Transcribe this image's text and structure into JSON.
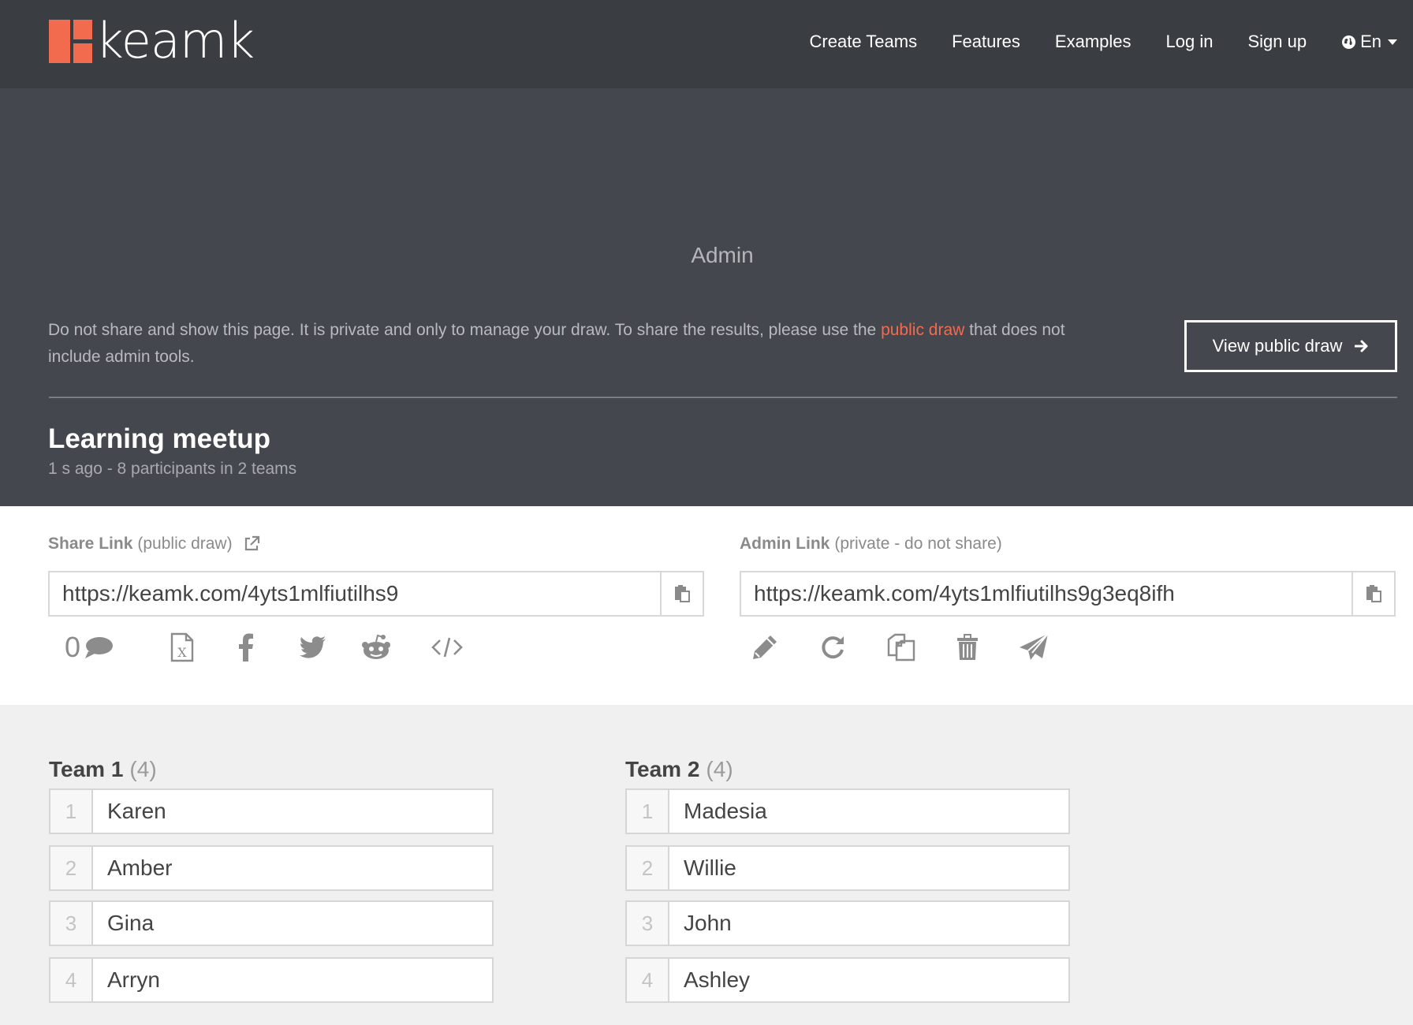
{
  "brand": {
    "name": "keamk",
    "accent": "#f26b4f"
  },
  "nav": {
    "items": [
      "Create Teams",
      "Features",
      "Examples",
      "Log in",
      "Sign up"
    ],
    "language": "En"
  },
  "hero": {
    "title": "Admin",
    "warning_before": "Do not share and show this page. It is private and only to manage your draw. To share the results, please use the ",
    "warning_link": "public draw",
    "warning_after": " that does not include admin tools.",
    "public_button": "View public draw",
    "draw_title": "Learning meetup",
    "draw_meta": "1 s ago - 8 participants in 2 teams"
  },
  "share": {
    "label_bold": "Share Link",
    "label_note": "(public draw)",
    "url": "https://keamk.com/4yts1mlfiutilhs9",
    "comment_count": "0",
    "icons": [
      "comment-icon",
      "excel-icon",
      "facebook-icon",
      "twitter-icon",
      "reddit-icon",
      "embed-code-icon"
    ]
  },
  "admin": {
    "label_bold": "Admin Link",
    "label_note": "(private - do not share)",
    "url": "https://keamk.com/4yts1mlfiutilhs9g3eq8ifh",
    "icons": [
      "edit-pencil-icon",
      "redraw-icon",
      "duplicate-icon",
      "delete-trash-icon",
      "send-icon"
    ]
  },
  "teams": [
    {
      "name": "Team 1",
      "count": "(4)",
      "members": [
        {
          "num": "1",
          "name": "Karen"
        },
        {
          "num": "2",
          "name": "Amber"
        },
        {
          "num": "3",
          "name": "Gina"
        },
        {
          "num": "4",
          "name": "Arryn"
        }
      ]
    },
    {
      "name": "Team 2",
      "count": "(4)",
      "members": [
        {
          "num": "1",
          "name": "Madesia"
        },
        {
          "num": "2",
          "name": "Willie"
        },
        {
          "num": "3",
          "name": "John"
        },
        {
          "num": "4",
          "name": "Ashley"
        }
      ]
    }
  ]
}
